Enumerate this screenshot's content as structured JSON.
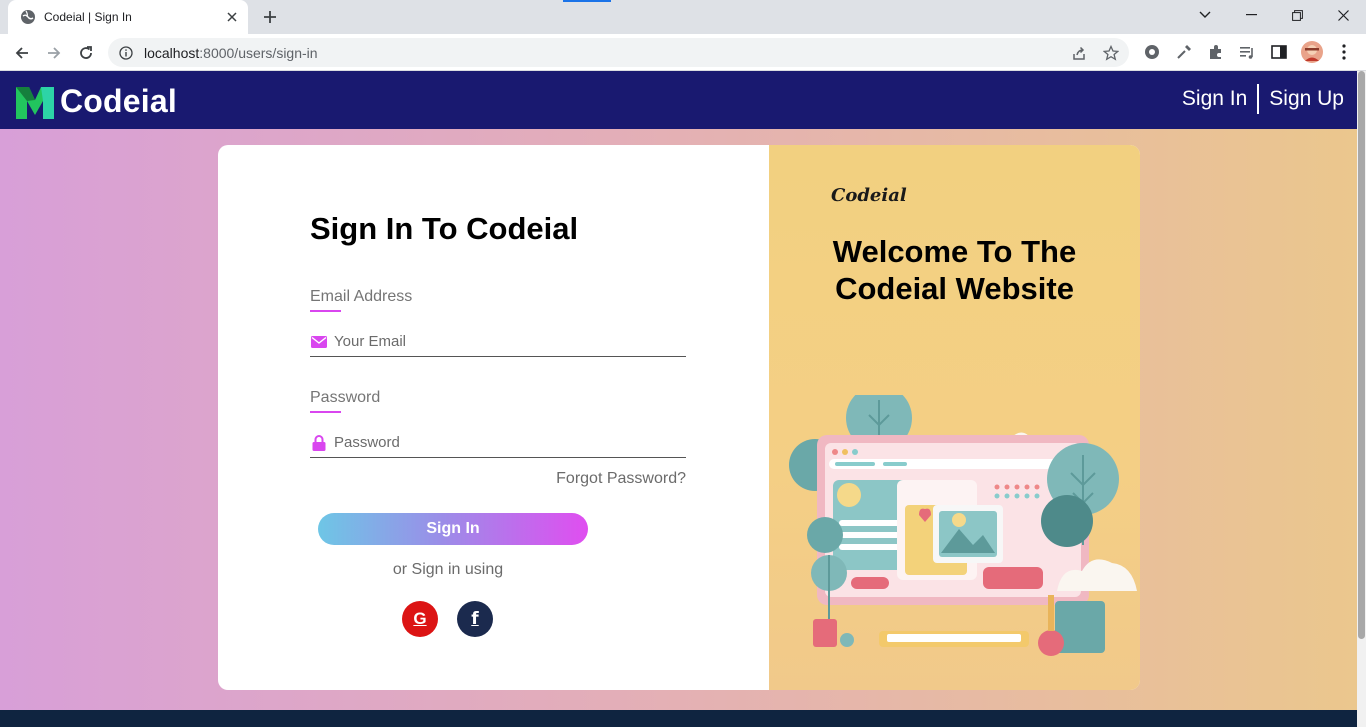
{
  "browser": {
    "tab_title": "Codeial | Sign In",
    "url_host": "localhost",
    "url_path": ":8000/users/sign-in"
  },
  "header": {
    "brand": "Codeial",
    "nav": {
      "sign_in": "Sign In",
      "sign_up": "Sign Up"
    }
  },
  "form": {
    "title": "Sign In To Codeial",
    "email_label": "Email Address",
    "email_placeholder": "Your Email",
    "password_label": "Password",
    "password_placeholder": "Password",
    "forgot": "Forgot Password?",
    "submit": "Sign In",
    "or_text": "or Sign in using",
    "social": {
      "google": "G",
      "facebook": "f"
    }
  },
  "promo": {
    "brand": "Codeial",
    "title": "Welcome To The Codeial Website"
  },
  "colors": {
    "header_bg": "#191970",
    "accent": "#d946ef",
    "google": "#dc1414",
    "facebook": "#1b2a4e",
    "logo_green": "#22c55e"
  },
  "icons": [
    "globe-icon",
    "close-icon",
    "plus-icon",
    "back-icon",
    "forward-icon",
    "reload-icon",
    "info-icon",
    "share-icon",
    "star-icon",
    "envelope-icon",
    "lock-icon",
    "google-icon",
    "facebook-icon"
  ]
}
